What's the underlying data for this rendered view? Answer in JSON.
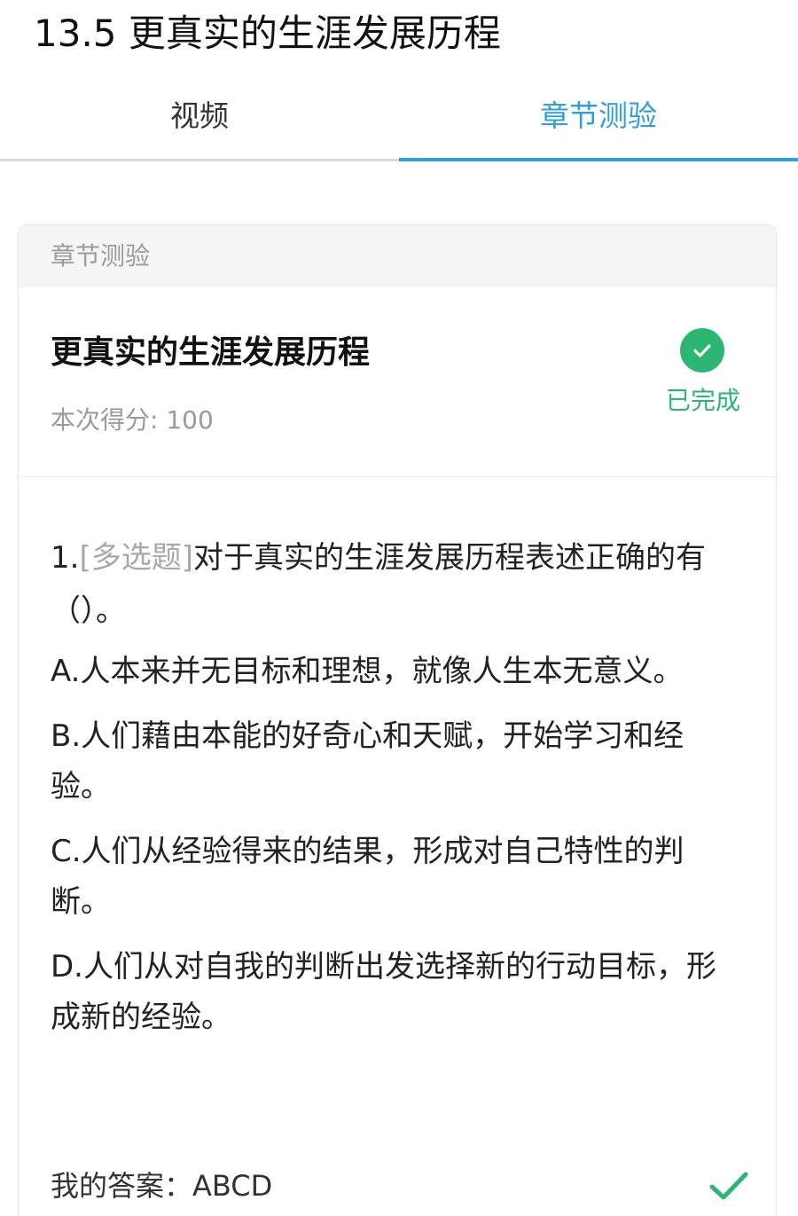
{
  "page": {
    "title": "13.5 更真实的生涯发展历程"
  },
  "tabs": [
    {
      "label": "视频",
      "active": false
    },
    {
      "label": "章节测验",
      "active": true
    }
  ],
  "card": {
    "header": "章节测验",
    "quiz_title": "更真实的生涯发展历程",
    "score_label": "本次得分:",
    "score_value": "100",
    "status": "已完成",
    "status_icon": "check-circle-icon"
  },
  "question": {
    "number": "1.",
    "type": "[多选题]",
    "text": "对于真实的生涯发展历程表述正确的有（）。",
    "options": [
      {
        "label": "A.人本来并无目标和理想，就像人生本无意义。"
      },
      {
        "label": "B.人们藉由本能的好奇心和天赋，开始学习和经验。"
      },
      {
        "label": "C.人们从经验得来的结果，形成对自己特性的判断。"
      },
      {
        "label": "D.人们从对自我的判断出发选择新的行动目标，形成新的经验。"
      }
    ]
  },
  "answer": {
    "label": "我的答案：",
    "value": "ABCD",
    "result_icon": "checkmark-icon"
  },
  "colors": {
    "accent": "#2e9fd8",
    "success": "#2bb673"
  }
}
